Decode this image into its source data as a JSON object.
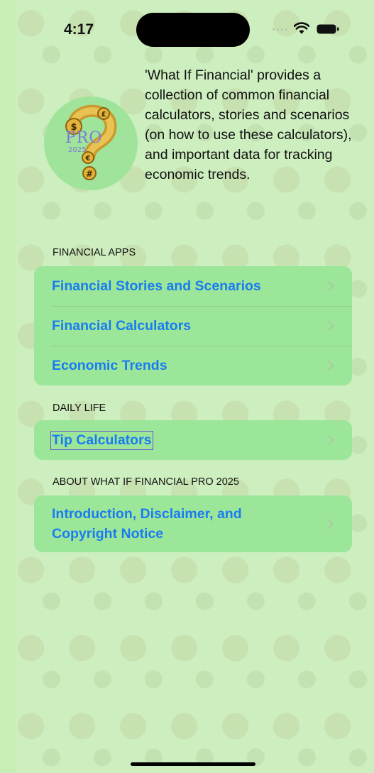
{
  "status_bar": {
    "time": "4:17"
  },
  "intro": "'What If Financial' provides a collection of common financial calculators, stories and scenarios (on how to use these calculators), and important data for tracking economic trends.",
  "logo": {
    "badge_text": "PRO",
    "year_text": "2025"
  },
  "sections": [
    {
      "header": "FINANCIAL APPS",
      "items": [
        {
          "label": "Financial Stories and Scenarios"
        },
        {
          "label": "Financial Calculators"
        },
        {
          "label": "Economic Trends"
        }
      ]
    },
    {
      "header": "DAILY LIFE",
      "items": [
        {
          "label": "Tip Calculators"
        }
      ]
    },
    {
      "header": "ABOUT WHAT IF FINANCIAL PRO 2025",
      "items": [
        {
          "label": "Introduction, Disclaimer, and Copyright Notice"
        }
      ]
    }
  ],
  "colors": {
    "background": "#cdeebf",
    "group_fill": "#9ce69a",
    "link": "#1a7cf0",
    "chevron": "#a9c9a6"
  }
}
